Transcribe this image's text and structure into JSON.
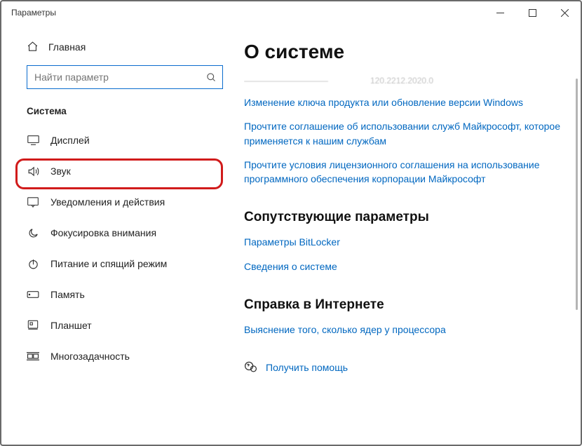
{
  "window": {
    "title": "Параметры"
  },
  "sidebar": {
    "home": "Главная",
    "search_placeholder": "Найти параметр",
    "section": "Система",
    "items": [
      {
        "label": "Дисплей"
      },
      {
        "label": "Звук"
      },
      {
        "label": "Уведомления и действия"
      },
      {
        "label": "Фокусировка внимания"
      },
      {
        "label": "Питание и спящий режим"
      },
      {
        "label": "Память"
      },
      {
        "label": "Планшет"
      },
      {
        "label": "Многозадачность"
      }
    ]
  },
  "main": {
    "heading": "О системе",
    "truncated_left": "——————————",
    "truncated_right": "120.2212.2020.0",
    "links": [
      "Изменение ключа продукта или обновление версии Windows",
      "Прочтите соглашение об использовании служб Майкрософт, которое применяется к нашим службам",
      "Прочтите условия лицензионного соглашения на использование программного обеспечения корпорации Майкрософт"
    ],
    "related_heading": "Сопутствующие параметры",
    "related_links": [
      "Параметры BitLocker",
      "Сведения о системе"
    ],
    "help_heading": "Справка в Интернете",
    "help_links": [
      "Выяснение того, сколько ядер у процессора"
    ],
    "get_help": "Получить помощь"
  }
}
